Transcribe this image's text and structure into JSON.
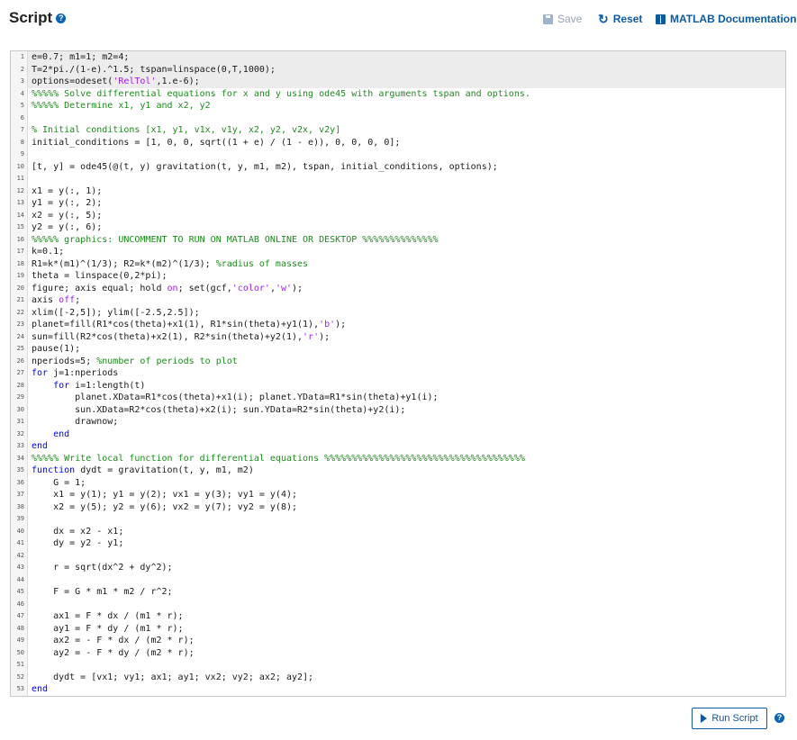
{
  "header": {
    "title": "Script",
    "help_icon": "?",
    "save_label": "Save",
    "reset_label": "Reset",
    "docs_label": "MATLAB Documentation"
  },
  "editor": {
    "lines": [
      [
        {
          "t": "e=0.7; m1=1; m2=4;"
        }
      ],
      [
        {
          "t": "T=2*pi./(1-e).^1.5; tspan=linspace(0,T,1000);"
        }
      ],
      [
        {
          "t": "options=odeset("
        },
        {
          "t": "'RelTol'",
          "c": "st"
        },
        {
          "t": ",1.e-6);"
        }
      ],
      [
        {
          "t": "%%%%% Solve differential equations for x and y using ode45 with arguments tspan and options.",
          "c": "cm"
        }
      ],
      [
        {
          "t": "%%%%% Determine x1, y1 and x2, y2",
          "c": "cm"
        }
      ],
      [
        {
          "t": ""
        }
      ],
      [
        {
          "t": "% Initial conditions [x1, y1, v1x, v1y, x2, y2, v2x, v2y]",
          "c": "cm"
        }
      ],
      [
        {
          "t": "initial_conditions = [1, 0, 0, sqrt((1 + e) / (1 - e)), 0, 0, 0, 0];"
        }
      ],
      [
        {
          "t": ""
        }
      ],
      [
        {
          "t": "[t, y] = ode45(@(t, y) gravitation(t, y, m1, m2), tspan, initial_conditions, options);"
        }
      ],
      [
        {
          "t": ""
        }
      ],
      [
        {
          "t": "x1 = y(:, 1);"
        }
      ],
      [
        {
          "t": "y1 = y(:, 2);"
        }
      ],
      [
        {
          "t": "x2 = y(:, 5);"
        }
      ],
      [
        {
          "t": "y2 = y(:, 6);"
        }
      ],
      [
        {
          "t": "%%%%% graphics: UNCOMMENT TO RUN ON MATLAB ONLINE OR DESKTOP %%%%%%%%%%%%%%",
          "c": "cm"
        }
      ],
      [
        {
          "t": "k=0.1;"
        }
      ],
      [
        {
          "t": "R1=k*(m1)^(1/3); R2=k*(m2)^(1/3); "
        },
        {
          "t": "%radius of masses",
          "c": "cm"
        }
      ],
      [
        {
          "t": "theta = linspace(0,2*pi);"
        }
      ],
      [
        {
          "t": "figure; axis equal; hold "
        },
        {
          "t": "on",
          "c": "st"
        },
        {
          "t": "; set(gcf,"
        },
        {
          "t": "'color'",
          "c": "st"
        },
        {
          "t": ","
        },
        {
          "t": "'w'",
          "c": "st"
        },
        {
          "t": ");"
        }
      ],
      [
        {
          "t": "axis "
        },
        {
          "t": "off",
          "c": "st"
        },
        {
          "t": ";"
        }
      ],
      [
        {
          "t": "xlim([-2,5]); ylim([-2.5,2.5]);"
        }
      ],
      [
        {
          "t": "planet=fill(R1*cos(theta)+x1(1), R1*sin(theta)+y1(1),"
        },
        {
          "t": "'b'",
          "c": "st"
        },
        {
          "t": ");"
        }
      ],
      [
        {
          "t": "sun=fill(R2*cos(theta)+x2(1), R2*sin(theta)+y2(1),"
        },
        {
          "t": "'r'",
          "c": "st"
        },
        {
          "t": ");"
        }
      ],
      [
        {
          "t": "pause(1);"
        }
      ],
      [
        {
          "t": "nperiods=5; "
        },
        {
          "t": "%number of periods to plot",
          "c": "cm"
        }
      ],
      [
        {
          "t": "for",
          "c": "kw"
        },
        {
          "t": " j=1:nperiods"
        }
      ],
      [
        {
          "t": "    "
        },
        {
          "t": "for",
          "c": "kw"
        },
        {
          "t": " i=1:length(t)"
        }
      ],
      [
        {
          "t": "        planet.XData=R1*cos(theta)+x1(i); planet.YData=R1*sin(theta)+y1(i);"
        }
      ],
      [
        {
          "t": "        sun.XData=R2*cos(theta)+x2(i); sun.YData=R2*sin(theta)+y2(i);"
        }
      ],
      [
        {
          "t": "        drawnow;"
        }
      ],
      [
        {
          "t": "    "
        },
        {
          "t": "end",
          "c": "kw"
        }
      ],
      [
        {
          "t": "end",
          "c": "kw"
        }
      ],
      [
        {
          "t": "%%%%% Write local function for differential equations %%%%%%%%%%%%%%%%%%%%%%%%%%%%%%%%%%%%%",
          "c": "cm"
        }
      ],
      [
        {
          "t": "function",
          "c": "kw"
        },
        {
          "t": " dydt = gravitation(t, y, m1, m2)"
        }
      ],
      [
        {
          "t": "    G = 1;"
        }
      ],
      [
        {
          "t": "    x1 = y(1); y1 = y(2); vx1 = y(3); vy1 = y(4);"
        }
      ],
      [
        {
          "t": "    x2 = y(5); y2 = y(6); vx2 = y(7); vy2 = y(8);"
        }
      ],
      [
        {
          "t": ""
        }
      ],
      [
        {
          "t": "    dx = x2 - x1;"
        }
      ],
      [
        {
          "t": "    dy = y2 - y1;"
        }
      ],
      [
        {
          "t": ""
        }
      ],
      [
        {
          "t": "    r = sqrt(dx^2 + dy^2);"
        }
      ],
      [
        {
          "t": ""
        }
      ],
      [
        {
          "t": "    F = G * m1 * m2 / r^2;"
        }
      ],
      [
        {
          "t": ""
        }
      ],
      [
        {
          "t": "    ax1 = F * dx / (m1 * r);"
        }
      ],
      [
        {
          "t": "    ay1 = F * dy / (m1 * r);"
        }
      ],
      [
        {
          "t": "    ax2 = - F * dx / (m2 * r);"
        }
      ],
      [
        {
          "t": "    ay2 = - F * dy / (m2 * r);"
        }
      ],
      [
        {
          "t": ""
        }
      ],
      [
        {
          "t": "    dydt = [vx1; vy1; ax1; ay1; vx2; vy2; ax2; ay2];"
        }
      ],
      [
        {
          "t": "end",
          "c": "kw"
        }
      ]
    ],
    "highlighted_lines": [
      1,
      2,
      3
    ]
  },
  "footer": {
    "run_label": "Run Script",
    "help_icon": "?"
  },
  "colors": {
    "accent": "#0b5aa6",
    "comment": "#1f8a1f",
    "keyword": "#0000ff",
    "string": "#a020f0"
  }
}
